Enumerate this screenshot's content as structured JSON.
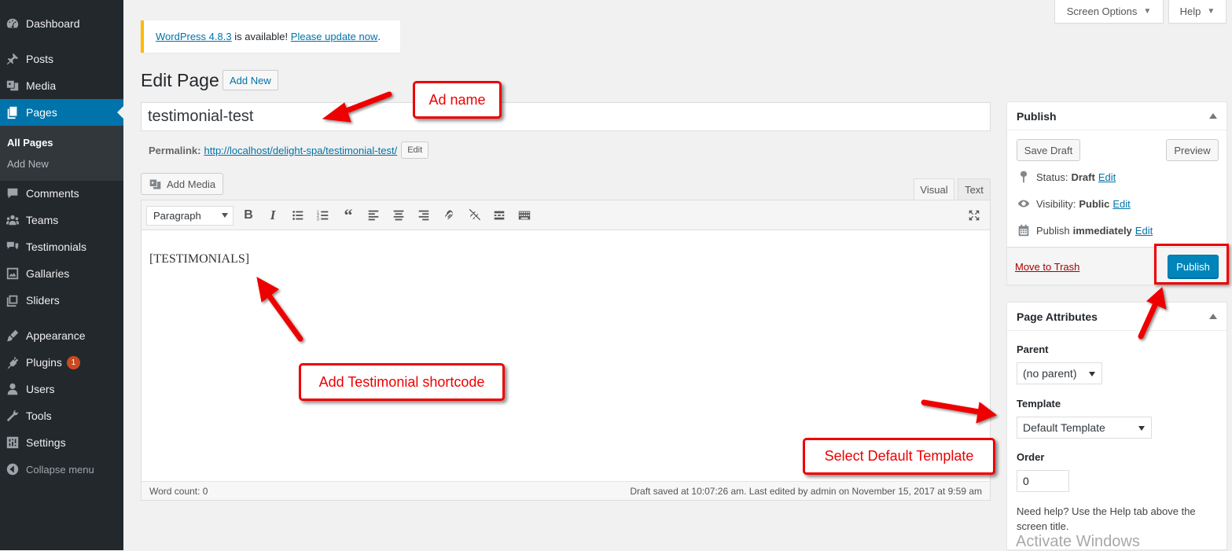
{
  "sidebar": {
    "items": [
      {
        "label": "Dashboard",
        "icon": "dashboard-icon"
      },
      {
        "label": "Posts",
        "icon": "pin-icon"
      },
      {
        "label": "Media",
        "icon": "media-icon"
      },
      {
        "label": "Pages",
        "icon": "pages-icon"
      },
      {
        "label": "Comments",
        "icon": "comment-icon"
      },
      {
        "label": "Teams",
        "icon": "groups-icon"
      },
      {
        "label": "Testimonials",
        "icon": "testimonial-icon"
      },
      {
        "label": "Gallaries",
        "icon": "gallery-icon"
      },
      {
        "label": "Sliders",
        "icon": "slides-icon"
      },
      {
        "label": "Appearance",
        "icon": "brush-icon"
      },
      {
        "label": "Plugins",
        "icon": "plugin-icon",
        "badge": "1"
      },
      {
        "label": "Users",
        "icon": "user-icon"
      },
      {
        "label": "Tools",
        "icon": "wrench-icon"
      },
      {
        "label": "Settings",
        "icon": "settings-icon"
      }
    ],
    "submenu": {
      "all_pages": "All Pages",
      "add_new": "Add New"
    },
    "collapse": "Collapse menu"
  },
  "top": {
    "screen_options": "Screen Options",
    "help": "Help"
  },
  "notice": {
    "version_link": "WordPress 4.8.3",
    "middle": "is available!",
    "update_link": "Please update now",
    "end": "."
  },
  "header": {
    "title": "Edit Page",
    "add_new": "Add New"
  },
  "post": {
    "title": "testimonial-test",
    "permalink_label": "Permalink:",
    "permalink_base": "http://localhost/delight-spa/",
    "permalink_slug": "testimonial-test",
    "permalink_end": "/",
    "edit_label": "Edit"
  },
  "editor": {
    "add_media": "Add Media",
    "tab_visual": "Visual",
    "tab_text": "Text",
    "format": "Paragraph",
    "content": "[TESTIMONIALS]",
    "word_count": "Word count: 0",
    "last_saved": "Draft saved at 10:07:26 am. Last edited by admin on November 15, 2017 at 9:59 am"
  },
  "publish": {
    "title": "Publish",
    "save_draft": "Save Draft",
    "preview": "Preview",
    "status_label": "Status:",
    "status_value": "Draft",
    "visibility_label": "Visibility:",
    "visibility_value": "Public",
    "publish_label": "Publish",
    "publish_value": "immediately",
    "edit": "Edit",
    "trash": "Move to Trash",
    "publish_button": "Publish"
  },
  "attributes": {
    "title": "Page Attributes",
    "parent_label": "Parent",
    "parent_value": "(no parent)",
    "template_label": "Template",
    "template_value": "Default Template",
    "order_label": "Order",
    "order_value": "0",
    "help": "Need help? Use the Help tab above the screen title."
  },
  "annotations": {
    "ad_name": "Ad name",
    "shortcode": "Add Testimonial shortcode",
    "template": "Select Default Template"
  },
  "watermark": "Activate Windows",
  "colors": {
    "sidebar": "#23282d",
    "active": "#0073aa",
    "annotation": "#e00000",
    "publish": "#0085ba"
  }
}
